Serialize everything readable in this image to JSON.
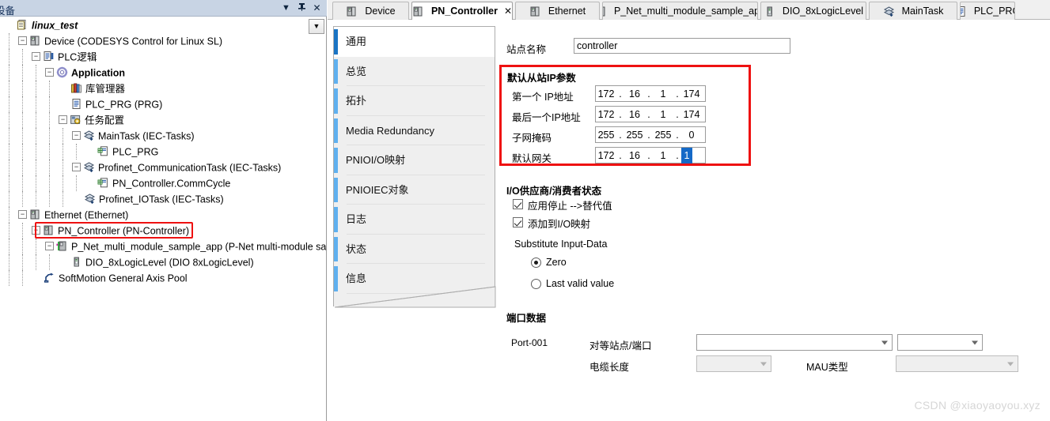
{
  "tree_panel": {
    "title": "设备",
    "buttons": {
      "dropdown": "▼",
      "pin": "⊹",
      "close": "✕",
      "overflow": "▼"
    },
    "items": [
      {
        "indent": 0,
        "expander": "",
        "icon": "project-icon",
        "label": "linux_test",
        "style": "italic"
      },
      {
        "indent": 1,
        "expander": "−",
        "icon": "device-icon",
        "label": "Device (CODESYS Control for Linux SL)",
        "style": "normal"
      },
      {
        "indent": 2,
        "expander": "−",
        "icon": "plc-logic-icon",
        "label": "PLC逻辑",
        "style": "normal"
      },
      {
        "indent": 3,
        "expander": "−",
        "icon": "application-icon",
        "label": "Application",
        "style": "bold"
      },
      {
        "indent": 4,
        "expander": "",
        "icon": "library-icon",
        "label": "库管理器",
        "style": "normal"
      },
      {
        "indent": 4,
        "expander": "",
        "icon": "prg-icon",
        "label": "PLC_PRG (PRG)",
        "style": "normal"
      },
      {
        "indent": 4,
        "expander": "−",
        "icon": "task-config-icon",
        "label": "任务配置",
        "style": "normal"
      },
      {
        "indent": 5,
        "expander": "−",
        "icon": "task-icon",
        "label": "MainTask (IEC-Tasks)",
        "style": "normal"
      },
      {
        "indent": 6,
        "expander": "",
        "icon": "pou-call-icon",
        "label": "PLC_PRG",
        "style": "normal"
      },
      {
        "indent": 5,
        "expander": "−",
        "icon": "task-icon",
        "label": "Profinet_CommunicationTask (IEC-Tasks)",
        "style": "normal"
      },
      {
        "indent": 6,
        "expander": "",
        "icon": "pou-call-icon",
        "label": "PN_Controller.CommCycle",
        "style": "normal"
      },
      {
        "indent": 5,
        "expander": "",
        "icon": "task-icon",
        "label": "Profinet_IOTask (IEC-Tasks)",
        "style": "normal"
      },
      {
        "indent": 1,
        "expander": "−",
        "icon": "device-icon",
        "label": "Ethernet (Ethernet)",
        "style": "normal"
      },
      {
        "indent": 2,
        "expander": "−",
        "icon": "device-icon",
        "label": "PN_Controller (PN-Controller)",
        "style": "normal"
      },
      {
        "indent": 3,
        "expander": "−",
        "icon": "pnet-device-icon",
        "label": "P_Net_multi_module_sample_app (P-Net multi-module sample ap",
        "style": "normal"
      },
      {
        "indent": 4,
        "expander": "",
        "icon": "module-icon",
        "label": "DIO_8xLogicLevel (DIO 8xLogicLevel)",
        "style": "normal"
      },
      {
        "indent": 2,
        "expander": "",
        "icon": "axis-pool-icon",
        "label": "SoftMotion General Axis Pool",
        "style": "normal"
      }
    ],
    "highlight_label": "PN_Controller (PN-Controller)"
  },
  "editor_tabs": [
    {
      "label": "Device",
      "icon": "device-icon",
      "active": false,
      "closable": false
    },
    {
      "label": "PN_Controller",
      "icon": "device-icon",
      "active": true,
      "closable": true,
      "close": "✕"
    },
    {
      "label": "Ethernet",
      "icon": "device-icon",
      "active": false,
      "closable": false
    },
    {
      "label": "P_Net_multi_module_sample_app",
      "icon": "pnet-device-icon",
      "active": false,
      "closable": false
    },
    {
      "label": "DIO_8xLogicLevel",
      "icon": "module-icon",
      "active": false,
      "closable": false
    },
    {
      "label": "MainTask",
      "icon": "task-icon",
      "active": false,
      "closable": false
    },
    {
      "label": "PLC_PRG",
      "icon": "prg-icon",
      "active": false,
      "closable": false
    }
  ],
  "category_tabs": [
    {
      "label": "通用",
      "active": true
    },
    {
      "label": "总览",
      "active": false
    },
    {
      "label": "拓扑",
      "active": false
    },
    {
      "label": "Media Redundancy",
      "active": false
    },
    {
      "label": "PNIOI/O映射",
      "active": false
    },
    {
      "label": "PNIOIEC对象",
      "active": false
    },
    {
      "label": "日志",
      "active": false
    },
    {
      "label": "状态",
      "active": false
    },
    {
      "label": "信息",
      "active": false
    }
  ],
  "form": {
    "station_name_label": "站点名称",
    "station_name_value": "controller",
    "ip_section_title": "默认从站IP参数",
    "ip_rows": [
      {
        "label": "第一个 IP地址",
        "octets": [
          "172",
          "16",
          "1",
          "174"
        ],
        "selected_index": -1
      },
      {
        "label": "最后一个IP地址",
        "octets": [
          "172",
          "16",
          "1",
          "174"
        ],
        "selected_index": -1
      },
      {
        "label": "子网掩码",
        "octets": [
          "255",
          "255",
          "255",
          "0"
        ],
        "selected_index": -1
      },
      {
        "label": "默认网关",
        "octets": [
          "172",
          "16",
          "1",
          "1"
        ],
        "selected_index": 3
      }
    ],
    "ip_dot": ".",
    "io_section_title": "I/O供应商/消费者状态",
    "checkbox_app_stop": {
      "label": "应用停止 -->替代值",
      "checked": true
    },
    "checkbox_add_io": {
      "label": "添加到I/O映射",
      "checked": true
    },
    "substitute_label": "Substitute Input-Data",
    "radio_zero": {
      "label": "Zero",
      "checked": true
    },
    "radio_last": {
      "label": "Last valid value",
      "checked": false
    },
    "port_section_title": "端口数据",
    "port_name": "Port-001",
    "peer_label": "对等站点/端口",
    "peer_value": "",
    "peer_port_value": "",
    "cable_label": "电缆长度",
    "cable_value": "",
    "mau_label": "MAU类型",
    "mau_value": ""
  },
  "watermark": "CSDN @xiaoyaoyou.xyz",
  "colors": {
    "titlebar": "#c8d4e4",
    "highlight_red": "#ee1111",
    "tab_accent_active": "#1a74c4",
    "tab_accent": "#5fb0ef",
    "selection_blue": "#1569c7",
    "panel_grey": "#efefef"
  }
}
